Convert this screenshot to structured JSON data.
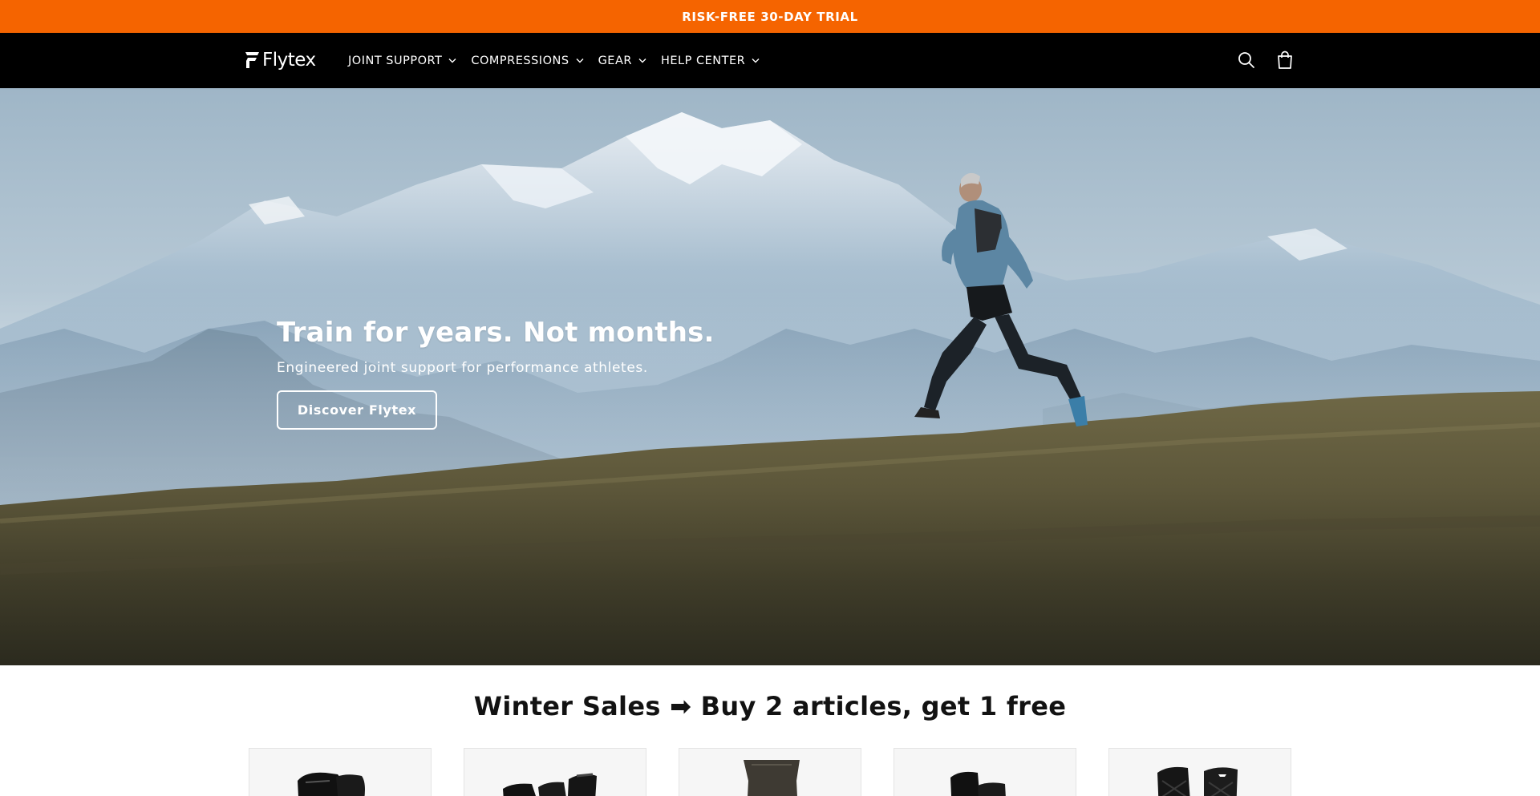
{
  "announcement": {
    "text": "RISK-FREE 30-DAY TRIAL"
  },
  "header": {
    "logo_text": "Flytex",
    "nav": [
      {
        "label": "JOINT SUPPORT"
      },
      {
        "label": "COMPRESSIONS"
      },
      {
        "label": "GEAR"
      },
      {
        "label": "HELP CENTER"
      }
    ],
    "icons": [
      "search-icon",
      "cart-icon"
    ]
  },
  "hero": {
    "title": "Train for years. Not months.",
    "subtitle": "Engineered joint support for performance athletes.",
    "cta_label": "Discover Flytex"
  },
  "promo": {
    "title": "Winter Sales ➡ Buy 2 articles, get 1 free"
  },
  "products": [
    {
      "name": "product-card-1"
    },
    {
      "name": "product-card-2"
    },
    {
      "name": "product-card-3"
    },
    {
      "name": "product-card-4"
    },
    {
      "name": "product-card-5"
    }
  ],
  "colors": {
    "announcement_bg": "#f56400",
    "header_bg": "#000000",
    "text": "#121212"
  }
}
